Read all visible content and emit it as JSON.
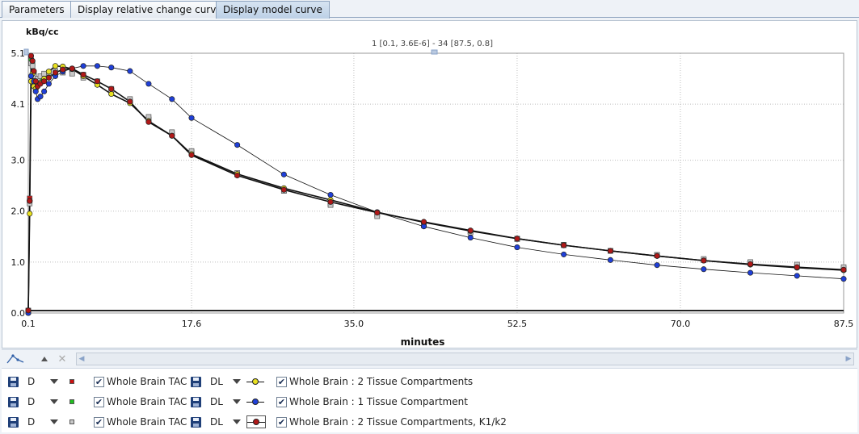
{
  "tabs": [
    {
      "label": "Parameters",
      "active": false
    },
    {
      "label": "Display relative change curve",
      "active": false
    },
    {
      "label": "Display model curve",
      "active": true
    }
  ],
  "chart_header": "1 [0.1, 3.6E-6] - 34 [87.5, 0.8]",
  "chart_data": {
    "type": "line",
    "ylabel": "kBq/cc",
    "xlabel": "minutes",
    "xlim": [
      0.1,
      87.5
    ],
    "ylim": [
      0.0,
      5.1
    ],
    "xticks": [
      0.1,
      17.6,
      35.0,
      52.5,
      70.0,
      87.5
    ],
    "xtick_labels": [
      "0.1",
      "17.6",
      "35.0",
      "52.5",
      "70.0",
      "87.5"
    ],
    "yticks": [
      0.0,
      1.0,
      2.0,
      3.0,
      4.1,
      5.1
    ],
    "ytick_labels": [
      "0.0",
      "1.0",
      "2.0",
      "3.0",
      "4.1",
      "5.1"
    ],
    "grid": true,
    "series": [
      {
        "name": "Whole Brain : 2 Tissue Compartments",
        "kind": "model",
        "color": "#e8e020",
        "curve": "2tc",
        "x": [
          0.1,
          0.25,
          0.4,
          0.55,
          0.7,
          0.9,
          1.1,
          1.4,
          1.8,
          2.3,
          3.0,
          3.8,
          4.8,
          6.0,
          7.5,
          9.0,
          11.0,
          13.0,
          15.5,
          17.6,
          22.5,
          27.5,
          32.5,
          37.5,
          42.5,
          47.5,
          52.5,
          57.5,
          62.5,
          67.5,
          72.5,
          77.5,
          82.5,
          87.5
        ],
        "y": [
          0.0,
          1.95,
          4.55,
          4.7,
          4.45,
          4.4,
          4.48,
          4.52,
          4.6,
          4.74,
          4.85,
          4.84,
          4.79,
          4.65,
          4.48,
          4.3,
          4.12,
          3.77,
          3.48,
          3.12,
          2.73,
          2.45,
          2.22,
          1.98,
          1.78,
          1.61,
          1.46,
          1.33,
          1.22,
          1.12,
          1.03,
          0.95,
          0.89,
          0.84
        ]
      },
      {
        "name": "Whole Brain : 1 Tissue Compartment",
        "kind": "model",
        "color": "#1f3fd8",
        "curve": "1tc",
        "x": [
          0.1,
          0.25,
          0.4,
          0.55,
          0.7,
          0.9,
          1.1,
          1.4,
          1.8,
          2.3,
          3.0,
          3.8,
          4.8,
          6.0,
          7.5,
          9.0,
          11.0,
          13.0,
          15.5,
          17.6,
          22.5,
          27.5,
          32.5,
          37.5,
          42.5,
          47.5,
          52.5,
          57.5,
          62.5,
          67.5,
          72.5,
          77.5,
          82.5,
          87.5
        ],
        "y": [
          0.0,
          2.2,
          4.65,
          4.95,
          4.55,
          4.35,
          4.2,
          4.25,
          4.35,
          4.5,
          4.65,
          4.74,
          4.8,
          4.85,
          4.85,
          4.82,
          4.75,
          4.5,
          4.2,
          3.83,
          3.3,
          2.72,
          2.32,
          1.98,
          1.7,
          1.48,
          1.29,
          1.15,
          1.04,
          0.94,
          0.86,
          0.79,
          0.73,
          0.67
        ]
      },
      {
        "name": "Whole Brain : 2 Tissue Compartments, K1/k2",
        "kind": "model",
        "color": "#b01818",
        "curve": "2tc",
        "x": [
          0.1,
          0.25,
          0.4,
          0.55,
          0.7,
          0.9,
          1.1,
          1.4,
          1.8,
          2.3,
          3.0,
          3.8,
          4.8,
          6.0,
          7.5,
          9.0,
          11.0,
          13.0,
          15.5,
          17.6,
          22.5,
          27.5,
          32.5,
          37.5,
          42.5,
          47.5,
          52.5,
          57.5,
          62.5,
          67.5,
          72.5,
          77.5,
          82.5,
          87.5
        ],
        "y": [
          0.05,
          2.2,
          5.05,
          4.95,
          4.75,
          4.55,
          4.45,
          4.5,
          4.55,
          4.62,
          4.72,
          4.78,
          4.8,
          4.68,
          4.55,
          4.4,
          4.15,
          3.75,
          3.48,
          3.1,
          2.7,
          2.42,
          2.18,
          1.97,
          1.79,
          1.62,
          1.46,
          1.33,
          1.22,
          1.12,
          1.03,
          0.96,
          0.9,
          0.85
        ]
      },
      {
        "name": "Whole Brain TAC (red)",
        "kind": "tac",
        "color": "#cc1010",
        "x": [
          0.1,
          0.25,
          0.4,
          0.55,
          0.7,
          0.9,
          1.1,
          1.4,
          1.8,
          2.3,
          3.0,
          3.8,
          4.8,
          6.0,
          7.5,
          9.0,
          11.0,
          13.0,
          15.5,
          17.6,
          22.5,
          27.5,
          32.5,
          37.5,
          42.5,
          47.5,
          52.5,
          57.5,
          62.5,
          67.5,
          72.5,
          77.5,
          82.5,
          87.5
        ],
        "y": [
          0.05,
          2.25,
          5.0,
          4.9,
          4.7,
          4.55,
          4.5,
          4.55,
          4.6,
          4.65,
          4.72,
          4.8,
          4.78,
          4.68,
          4.55,
          4.4,
          4.17,
          3.8,
          3.52,
          3.15,
          2.72,
          2.4,
          2.14,
          1.94,
          1.76,
          1.6,
          1.46,
          1.34,
          1.22,
          1.14,
          1.04,
          0.98,
          0.92,
          0.86
        ]
      },
      {
        "name": "Whole Brain TAC (green)",
        "kind": "tac",
        "color": "#20c020",
        "x": [
          0.1,
          0.25,
          0.4,
          0.55,
          0.7,
          0.9,
          1.1,
          1.4,
          1.8,
          2.3,
          3.0,
          3.8,
          4.8,
          6.0,
          7.5,
          9.0,
          11.0,
          13.0,
          15.5,
          17.6,
          22.5,
          27.5,
          32.5,
          37.5,
          42.5,
          47.5,
          52.5,
          57.5,
          62.5,
          67.5,
          72.5,
          77.5,
          82.5,
          87.5
        ],
        "y": [
          0.04,
          2.2,
          4.95,
          4.88,
          4.68,
          4.55,
          4.5,
          4.55,
          4.6,
          4.65,
          4.72,
          4.78,
          4.76,
          4.66,
          4.53,
          4.38,
          4.15,
          3.8,
          3.5,
          3.15,
          2.72,
          2.4,
          2.14,
          1.93,
          1.75,
          1.6,
          1.46,
          1.34,
          1.22,
          1.13,
          1.04,
          0.97,
          0.91,
          0.86
        ]
      },
      {
        "name": "Whole Brain TAC (gray)",
        "kind": "tac",
        "color": "#c8c8c8",
        "x": [
          0.1,
          0.25,
          0.4,
          0.55,
          0.7,
          0.9,
          1.1,
          1.4,
          1.8,
          2.3,
          3.0,
          3.8,
          4.8,
          6.0,
          7.5,
          9.0,
          11.0,
          13.0,
          15.5,
          17.6,
          22.5,
          27.5,
          32.5,
          37.5,
          42.5,
          47.5,
          52.5,
          57.5,
          62.5,
          67.5,
          72.5,
          77.5,
          82.5,
          87.5
        ],
        "y": [
          0.03,
          2.15,
          4.9,
          4.85,
          4.65,
          4.55,
          4.6,
          4.65,
          4.7,
          4.72,
          4.75,
          4.72,
          4.7,
          4.62,
          4.5,
          4.35,
          4.2,
          3.85,
          3.55,
          3.18,
          2.75,
          2.4,
          2.12,
          1.9,
          1.72,
          1.58,
          1.45,
          1.33,
          1.22,
          1.14,
          1.06,
          1.0,
          0.95,
          0.9
        ]
      }
    ]
  },
  "legend": [
    {
      "tac_mode": "D",
      "tac_color": "#cc1010",
      "tac_label": "Whole Brain TAC",
      "model_mode": "DL",
      "model_label": "Whole Brain : 2 Tissue Compartments",
      "model_color": "#e8e020",
      "boxed": false
    },
    {
      "tac_mode": "D",
      "tac_color": "#20c020",
      "tac_label": "Whole Brain TAC",
      "model_mode": "DL",
      "model_label": "Whole Brain : 1 Tissue Compartment",
      "model_color": "#1f3fd8",
      "boxed": false
    },
    {
      "tac_mode": "D",
      "tac_color": "#c8c8c8",
      "tac_label": "Whole Brain TAC",
      "model_mode": "DL",
      "model_label": "Whole Brain : 2 Tissue Compartments, K1/k2",
      "model_color": "#b01818",
      "boxed": true
    }
  ],
  "checkmark": "✔",
  "icons": {
    "curve_tool": "curve-icon",
    "up": "triangle-up-icon",
    "close": "close-icon",
    "scroll_left": "arrow-left-icon",
    "scroll_right": "arrow-right-icon"
  }
}
